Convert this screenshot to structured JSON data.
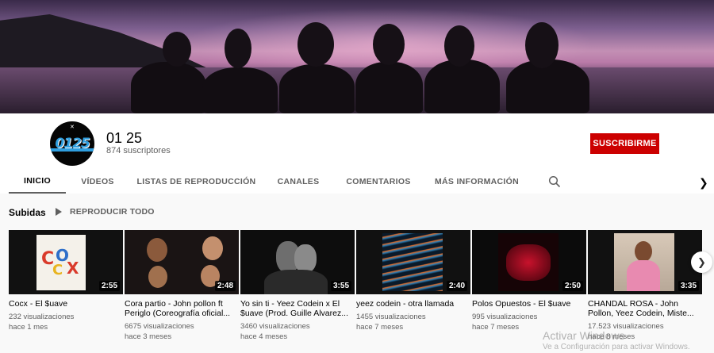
{
  "channel": {
    "name": "01 25",
    "subscribers": "874 suscriptores",
    "subscribe_label": "SUSCRIBIRME",
    "avatar_text": "0125"
  },
  "tabs": [
    {
      "label": "INICIO",
      "active": true
    },
    {
      "label": "VÍDEOS",
      "active": false
    },
    {
      "label": "LISTAS DE REPRODUCCIÓN",
      "active": false
    },
    {
      "label": "CANALES",
      "active": false
    },
    {
      "label": "COMENTARIOS",
      "active": false
    },
    {
      "label": "MÁS INFORMACIÓN",
      "active": false
    }
  ],
  "icons": {
    "tab_search": "search-icon",
    "tab_next": "chevron-right-icon",
    "play_all": "play-icon",
    "carousel_next": "chevron-right-icon"
  },
  "section": {
    "title": "Subidas",
    "play_all_label": "REPRODUCIR TODO"
  },
  "videos": [
    {
      "title": "Cocx - El $uave",
      "views": "232 visualizaciones",
      "age": "hace 1 mes",
      "duration": "2:55",
      "thumb_colors": [
        "#f4f1ea",
        "#d93a2b",
        "#2e6fc9"
      ]
    },
    {
      "title": "Cora partio - John pollon ft Periglo (Coreografía oficial...",
      "views": "6675 visualizaciones",
      "age": "hace 3 meses",
      "duration": "2:48",
      "thumb_colors": [
        "#1a1414",
        "#c4906e",
        "#3a2a2a"
      ]
    },
    {
      "title": "Yo sin ti - Yeez Codein x El $uave (Prod. Guille Alvarez...",
      "views": "3460 visualizaciones",
      "age": "hace 4 meses",
      "duration": "3:55",
      "thumb_colors": [
        "#0d0d0d",
        "#8a8a8a",
        "#2a2a2a"
      ]
    },
    {
      "title": "yeez codein - otra llamada",
      "views": "1455 visualizaciones",
      "age": "hace 7 meses",
      "duration": "2:40",
      "thumb_colors": [
        "#0a1a2a",
        "#d96a2a",
        "#2a7ab0"
      ]
    },
    {
      "title": "Polos Opuestos - El $uave",
      "views": "995 visualizaciones",
      "age": "hace 7 meses",
      "duration": "2:50",
      "thumb_colors": [
        "#0b0b0b",
        "#c8122c",
        "#e8e8e8"
      ]
    },
    {
      "title": "CHANDAL ROSA - John Pollon, Yeez Codein, Miste...",
      "views": "17.523 visualizaciones",
      "age": "hace 8 meses",
      "duration": "3:35",
      "thumb_colors": [
        "#d8c9b8",
        "#e88ab0",
        "#f2c94c"
      ]
    }
  ],
  "watermark": {
    "line1": "Activar Windows",
    "line2": "Ve a Configuración para activar Windows."
  },
  "colors": {
    "subscribe": "#cc0000",
    "text_primary": "#030303",
    "text_secondary": "#606060"
  }
}
